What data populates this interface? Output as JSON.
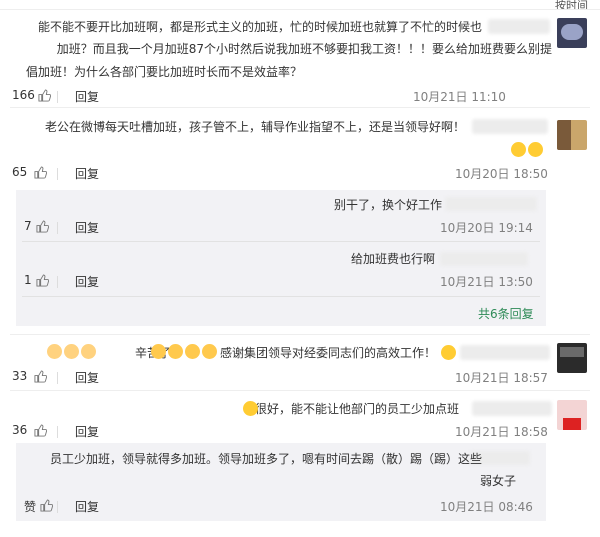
{
  "header": {
    "label": "按时间"
  },
  "comments": [
    {
      "lines": [
        "能不能不要开比加班啊，都是形式主义的加班，忙的时候加班也就算了不忙的时候也",
        "加班？而且我一个月加班87个小时然后说我加班不够要扣我工资！！！要么给加班费要么别提",
        "倡加班！为什么各部门要比加班时长而不是效益率？"
      ],
      "time": "10月21日 11:10",
      "reply_label": "回复",
      "likes": "166"
    },
    {
      "lines": [
        "老公在微博每天吐槽加班，孩子管不上，辅导作业指望不上，还是当领导好啊！"
      ],
      "time": "10月20日 18:50",
      "reply_label": "回复",
      "likes": "65",
      "replies": [
        {
          "text": "别干了，换个好工作",
          "time": "10月20日 19:14",
          "reply_label": "回复",
          "likes": "7"
        },
        {
          "text": "给加班费也行啊",
          "time": "10月21日 13:50",
          "reply_label": "回复",
          "likes": "1"
        }
      ],
      "more_label": "共6条回复"
    },
    {
      "text": "感谢集团领导对经委同志们的高效工作！",
      "tail": "辛苦了！",
      "time": "10月21日 18:57",
      "reply_label": "回复",
      "likes": "33"
    },
    {
      "text": "很好，能不能让他部门的员工少加点班",
      "time": "10月21日 18:58",
      "reply_label": "回复",
      "likes": "36",
      "reply": {
        "lines": [
          "员工少加班，领导就得多加班。领导加班多了，嗯有时间去踢（散）踢（踢）这些",
          "弱女子"
        ],
        "time": "10月21日 08:46",
        "reply_label": "回复",
        "likes": "赞"
      }
    }
  ],
  "colors": {
    "accent": "#2e8b57",
    "timestamp": "#808080",
    "sub_bg": "#f2f2f5"
  }
}
